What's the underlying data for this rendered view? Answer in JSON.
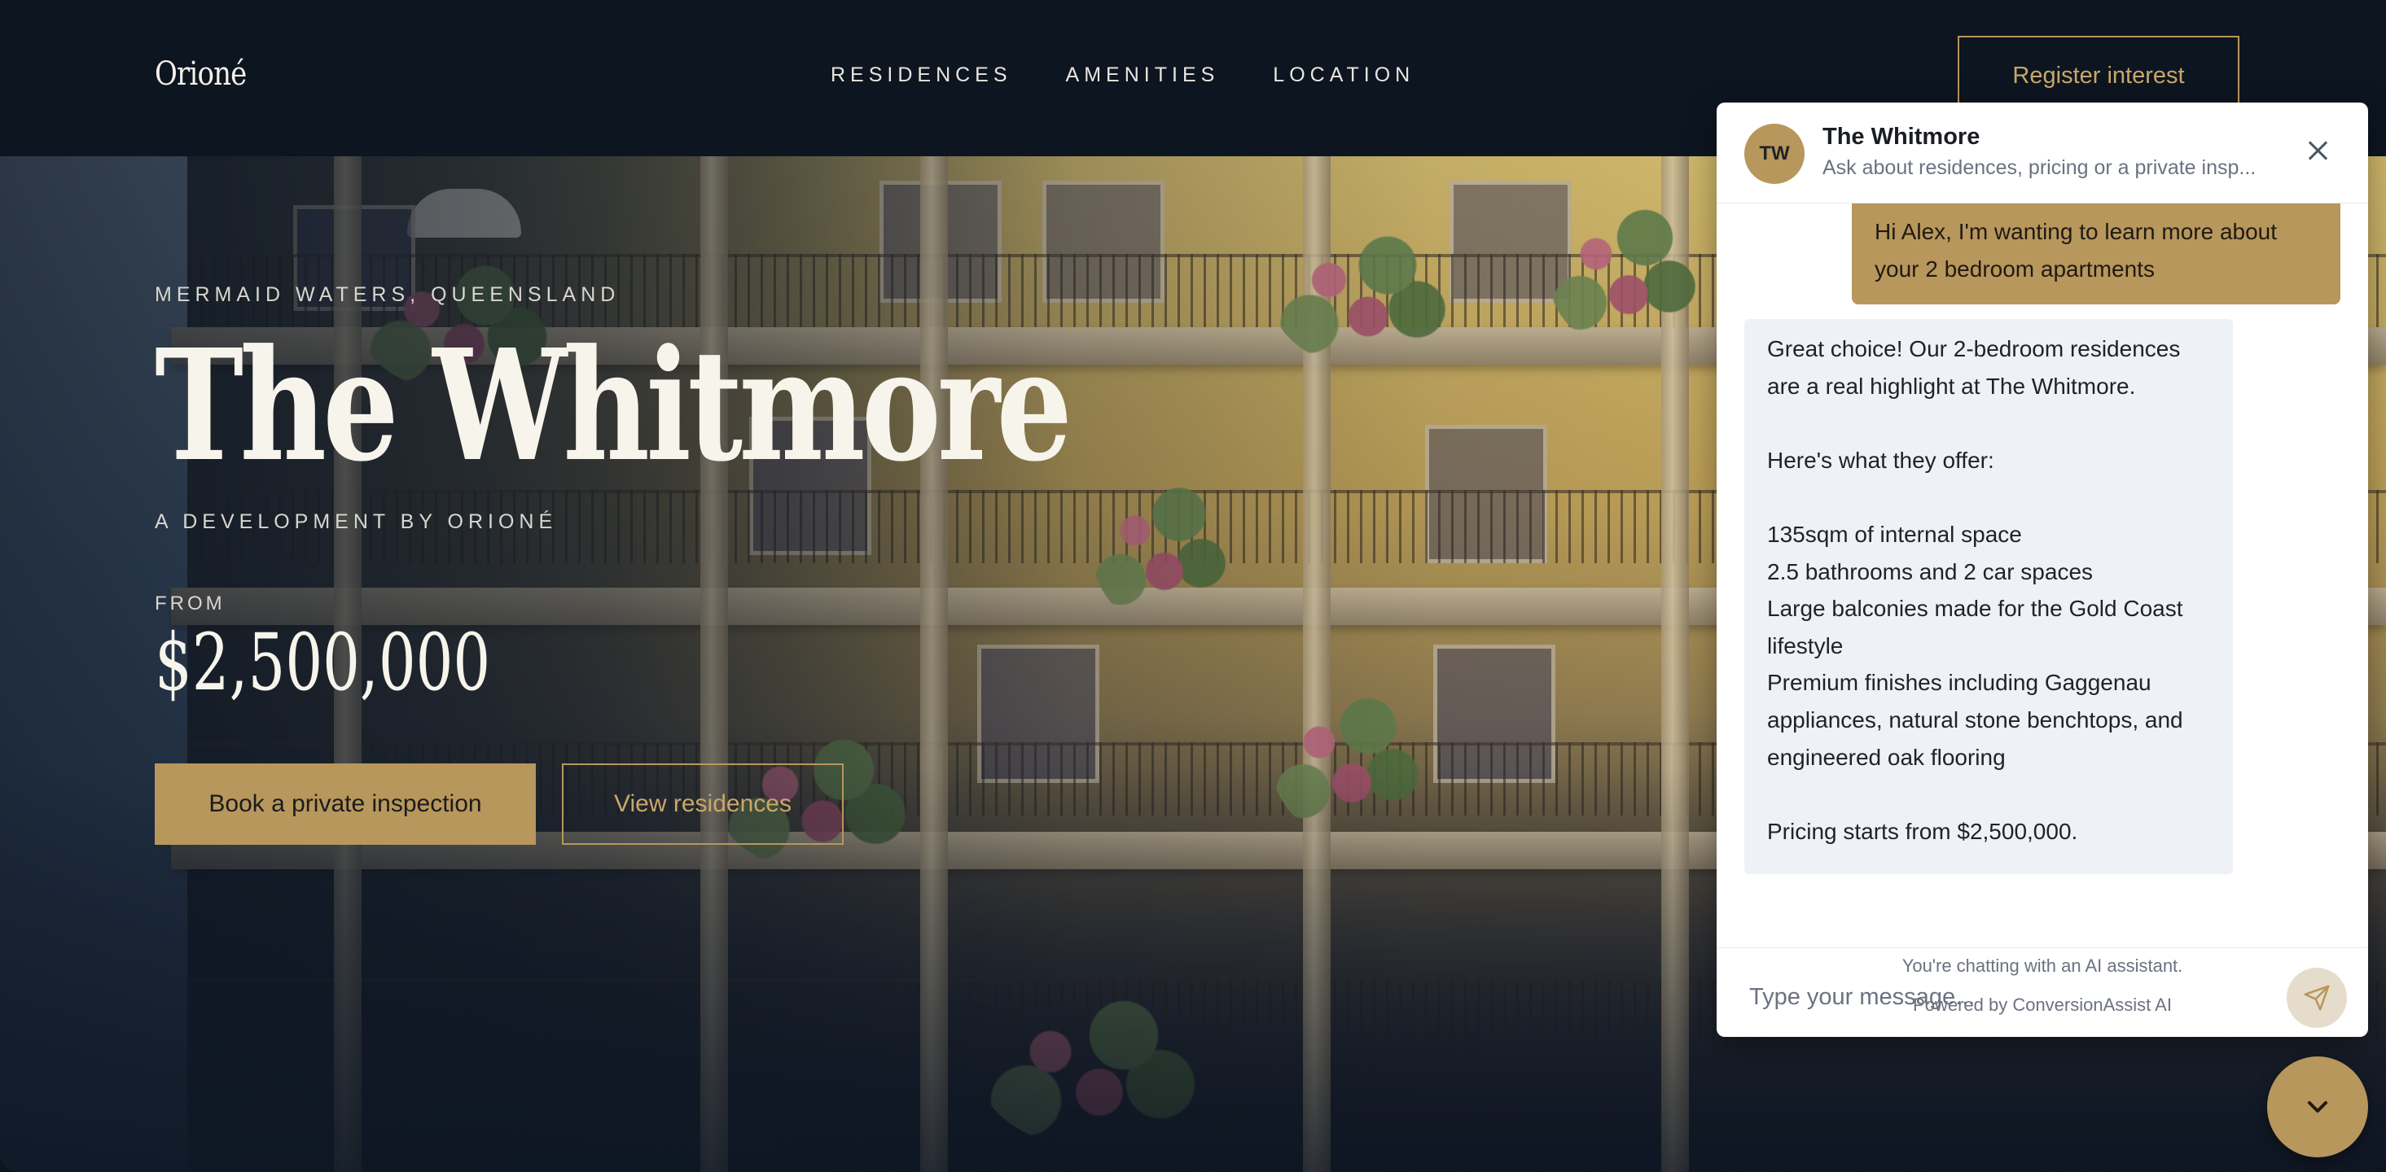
{
  "brand": {
    "logo": "Orioné"
  },
  "nav": {
    "items": [
      "RESIDENCES",
      "AMENITIES",
      "LOCATION"
    ]
  },
  "header": {
    "cta_label": "Register interest"
  },
  "hero": {
    "eyebrow": "MERMAID WATERS, QUEENSLAND",
    "title": "The Whitmore",
    "developer": "A DEVELOPMENT BY ORIONÉ",
    "from_label": "FROM",
    "price": "$2,500,000",
    "primary_cta": "Book a private inspection",
    "secondary_cta": "View residences"
  },
  "chat": {
    "avatar_initials": "TW",
    "name": "The Whitmore",
    "subtitle": "Ask about residences, pricing or a private insp...",
    "messages": [
      {
        "role": "user",
        "text": "Hi Alex, I'm wanting to learn more about your 2 bedroom apartments"
      },
      {
        "role": "assistant",
        "text": "Great choice! Our 2-bedroom residences are a real highlight at The Whitmore.\n\nHere's what they offer:\n\n135sqm of internal space\n2.5 bathrooms and 2 car spaces\nLarge balconies made for the Gold Coast lifestyle\nPremium finishes including Gaggenau appliances, natural stone benchtops, and engineered oak flooring\n\nPricing starts from $2,500,000."
      }
    ],
    "input_placeholder": "Type your message...",
    "disclaimer": "You're chatting with an AI assistant.",
    "powered_by": "Powered by ConversionAssist AI"
  },
  "colors": {
    "accent": "#b8975c",
    "header_bg": "#0d1520",
    "bot_bubble": "#eef1f6"
  },
  "icons": {
    "close": "close-icon",
    "send": "send-icon",
    "toggle": "chevron-down-icon"
  }
}
